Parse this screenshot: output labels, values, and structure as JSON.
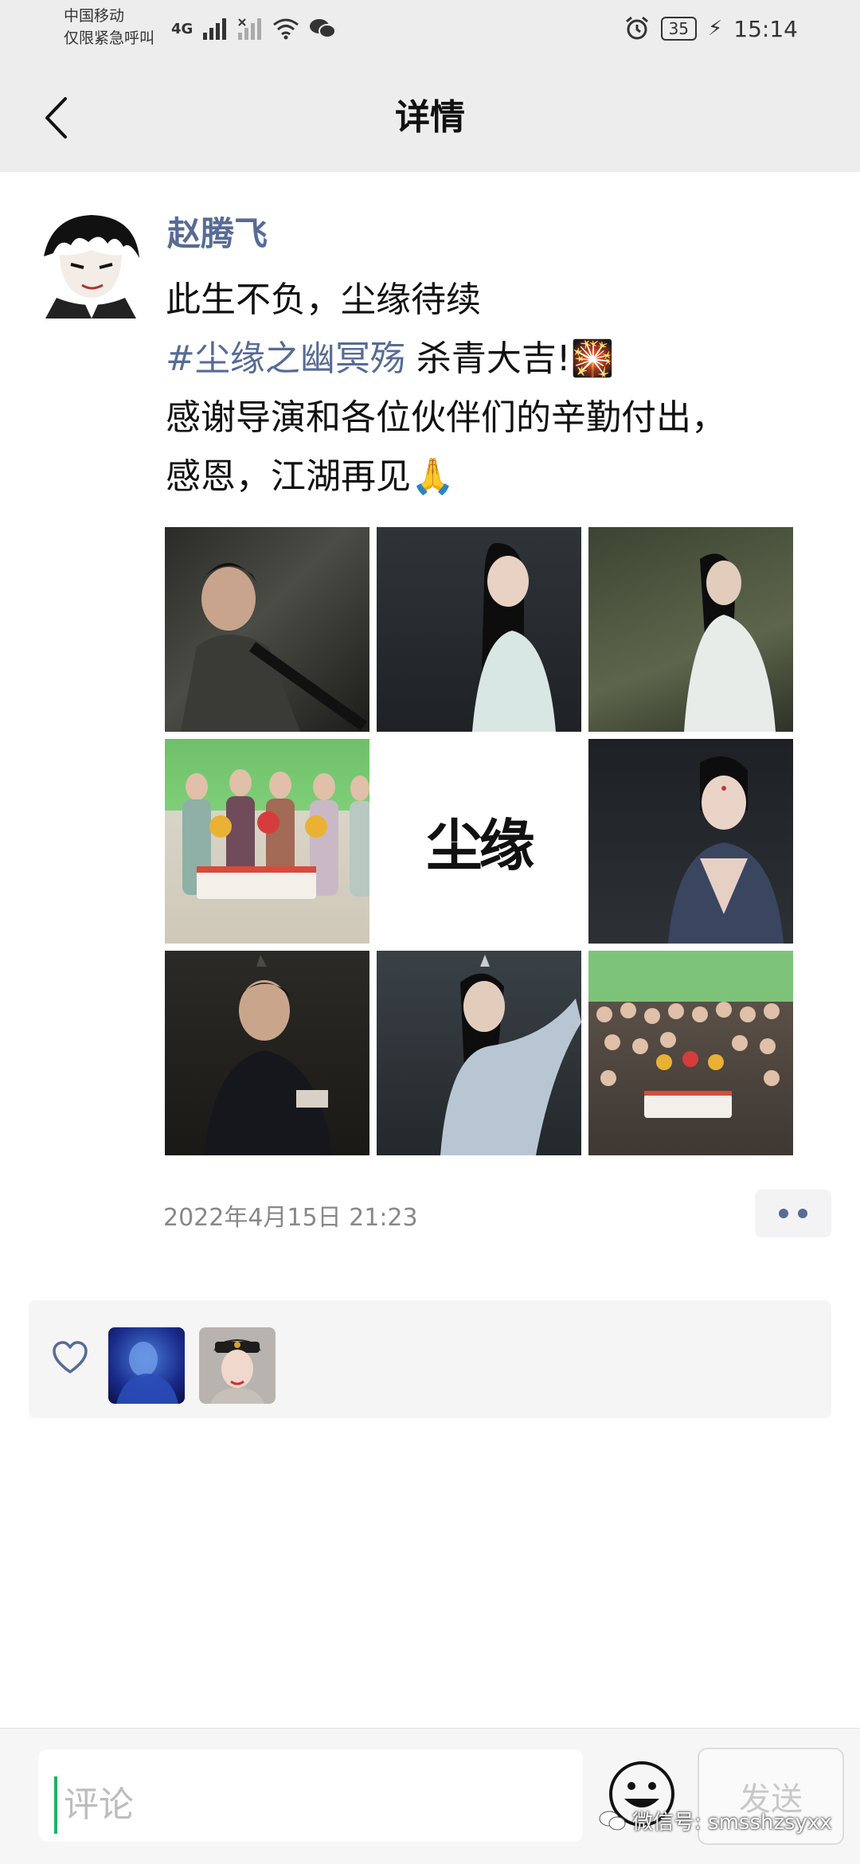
{
  "status_bar": {
    "carrier_line1": "中国移动",
    "carrier_line2": "仅限紧急呼叫",
    "network": "4G",
    "battery": "35",
    "time": "15:14"
  },
  "nav": {
    "title": "详情"
  },
  "post": {
    "author": "赵腾飞",
    "lines": [
      "此生不负，尘缘待续",
      "感谢导演和各位伙伴们的辛勤付出，",
      "感恩，江湖再见"
    ],
    "hashtag": "#尘缘之幽冥殇",
    "hashtag_tail": " 杀青大吉!",
    "emoji_firework": "🎇",
    "emoji_pray": "🙏",
    "photo_logo_text": "尘缘",
    "timestamp": "2022年4月15日 21:23"
  },
  "comment_bar": {
    "placeholder": "评论",
    "send_label": "发送"
  },
  "watermark": "微信号: smsshzsyxx",
  "colors": {
    "link": "#576b95",
    "accent_green": "#19b36b",
    "bar_bg": "#ededed"
  }
}
